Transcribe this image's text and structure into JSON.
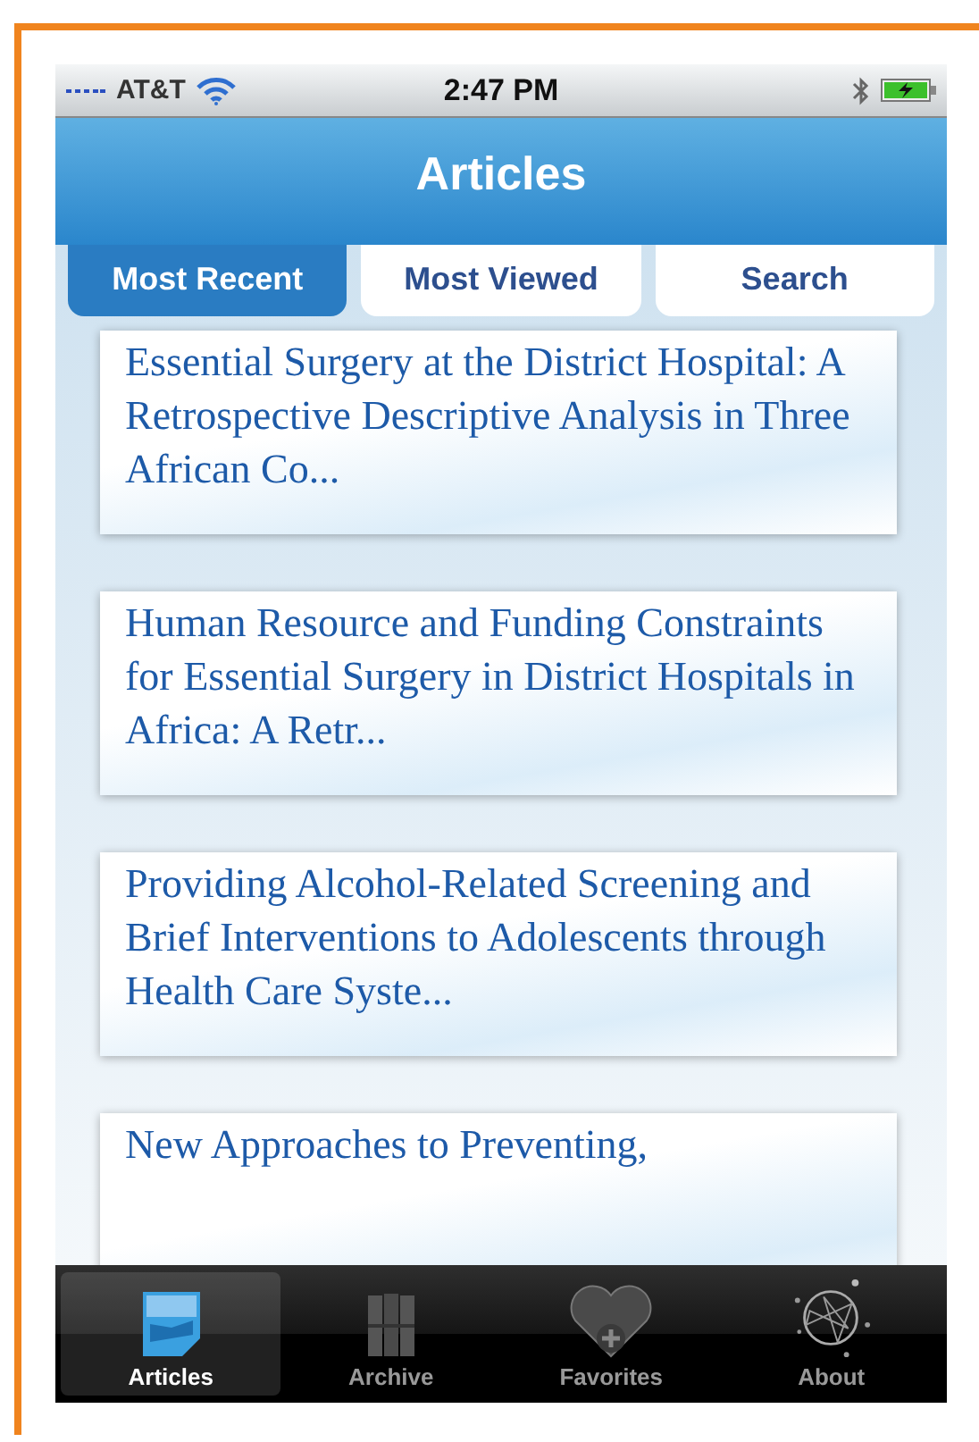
{
  "status_bar": {
    "carrier": "AT&T",
    "time": "2:47 PM"
  },
  "nav": {
    "title": "Articles"
  },
  "tabs": [
    {
      "label": "Most Recent",
      "selected": true
    },
    {
      "label": "Most Viewed",
      "selected": false
    },
    {
      "label": "Search",
      "selected": false
    }
  ],
  "articles": [
    {
      "title": "Essential Surgery at the District Hospital: A Retrospective Descriptive Analysis in Three African Co..."
    },
    {
      "title": "Human Resource and Funding Constraints for Essential Surgery in District Hospitals in Africa: A Retr..."
    },
    {
      "title": "Providing Alcohol-Related Screening and Brief Interventions to Adolescents through Health Care Syste..."
    },
    {
      "title": "New Approaches to Preventing,"
    }
  ],
  "tab_bar": [
    {
      "kind": "articles",
      "label": "Articles",
      "selected": true
    },
    {
      "kind": "archive",
      "label": "Archive",
      "selected": false
    },
    {
      "kind": "favorites",
      "label": "Favorites",
      "selected": false
    },
    {
      "kind": "about",
      "label": "About",
      "selected": false
    }
  ]
}
